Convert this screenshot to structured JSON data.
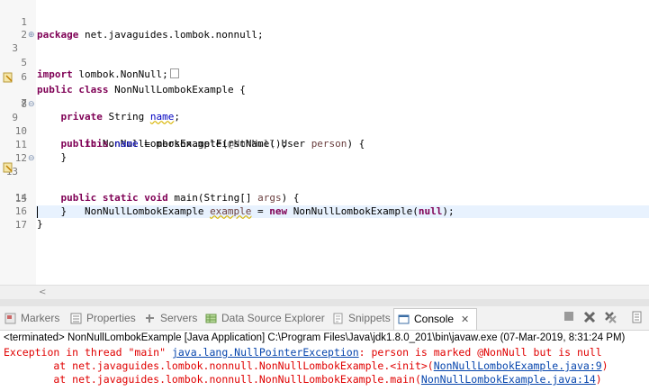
{
  "editor": {
    "lines": [
      {
        "num": "1"
      },
      {
        "num": "2"
      },
      {
        "num": "3"
      },
      {
        "num": "5"
      },
      {
        "num": "6"
      },
      {
        "num": "7"
      },
      {
        "num": "8"
      },
      {
        "num": "9"
      },
      {
        "num": "10"
      },
      {
        "num": "11"
      },
      {
        "num": "12"
      },
      {
        "num": "13"
      },
      {
        "num": "14"
      },
      {
        "num": "15"
      },
      {
        "num": "16"
      },
      {
        "num": "17"
      }
    ],
    "l1": {
      "kw": "package",
      "rest": " net.javaguides.lombok.nonnull;"
    },
    "l3": {
      "kw": "import",
      "rest": " lombok.NonNull;"
    },
    "l6": {
      "kw1": "public",
      "kw2": "class",
      "rest": " NonNullLombokExample {"
    },
    "l7": {
      "kw": "private",
      "type": " String ",
      "field": "name",
      "end": ";"
    },
    "l9": {
      "kw": "public",
      "a": " NonNullLombokExample(",
      "ann": "@NonNull",
      "b": " User ",
      "param": "person",
      "c": ") {"
    },
    "l10": {
      "kw": "this",
      "dot": ".",
      "field": "name",
      "rest": " = person.getFirstName();"
    },
    "l11": {
      "text": "}"
    },
    "l13": {
      "kw1": "public",
      "kw2": "static",
      "kw3": "void",
      "a": " main(String[] ",
      "param": "args",
      "b": ") {"
    },
    "l14": {
      "a": "NonNullLombokExample ",
      "var": "example",
      "b": " = ",
      "kw": "new",
      "c": " NonNullLombokExample(",
      "kw2": "null",
      "d": ");"
    },
    "l15": {
      "text": "}"
    },
    "l16": {
      "text": "}"
    }
  },
  "tabs": {
    "markers": "Markers",
    "properties": "Properties",
    "servers": "Servers",
    "datasource": "Data Source Explorer",
    "snippets": "Snippets",
    "console": "Console",
    "console_close": "✕"
  },
  "console": {
    "terminated": "<terminated> NonNullLombokExample [Java Application] C:\\Program Files\\Java\\jdk1.8.0_201\\bin\\javaw.exe (07-Mar-2019, 8:31:24 PM)",
    "e1a": "Exception in thread \"main\" ",
    "e1link": "java.lang.NullPointerException",
    "e1b": ": person is marked @NonNull but is null",
    "e2a": "        at net.javaguides.lombok.nonnull.NonNullLombokExample.<init>(",
    "e2link": "NonNullLombokExample.java:9",
    "e2b": ")",
    "e3a": "        at net.javaguides.lombok.nonnull.NonNullLombokExample.main(",
    "e3link": "NonNullLombokExample.java:14",
    "e3b": ")"
  },
  "colors": {
    "keyword": "#7f0055",
    "field": "#0000c0",
    "error": "#e00000",
    "link": "#0645ad"
  }
}
